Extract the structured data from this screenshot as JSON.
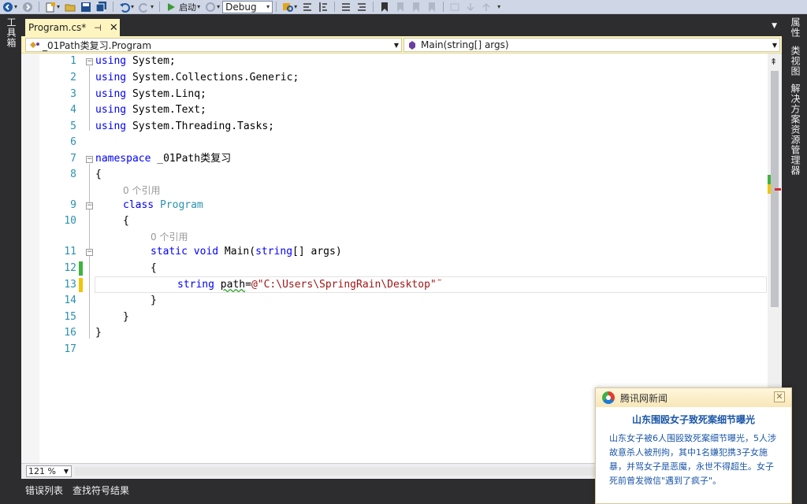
{
  "toolbar": {
    "start_label": "启动",
    "config_value": "Debug"
  },
  "left_strip": {
    "toolbox_label": "工具箱"
  },
  "right_strip": {
    "properties_label": "属性",
    "class_view_label": "类视图",
    "solution_explorer_label": "解决方案资源管理器"
  },
  "tab": {
    "title": "Program.cs*",
    "pin": "⊣",
    "close": "✕"
  },
  "nav": {
    "type_combo": "_01Path类复习.Program",
    "member_combo": "Main(string[] args)"
  },
  "editor": {
    "line_numbers": [
      "1",
      "2",
      "3",
      "4",
      "5",
      "6",
      "7",
      "8",
      "9",
      "10",
      "11",
      "12",
      "13",
      "14",
      "15",
      "16",
      "17"
    ],
    "codelens_class": "0 个引用",
    "codelens_method": "0 个引用",
    "lines": {
      "l1_kw": "using",
      "l1_rest": " System;",
      "l2_kw": "using",
      "l2_rest": " System.Collections.Generic;",
      "l3_kw": "using",
      "l3_rest": " System.Linq;",
      "l4_kw": "using",
      "l4_rest": " System.Text;",
      "l5_kw": "using",
      "l5_rest": " System.Threading.Tasks;",
      "l7_kw": "namespace",
      "l7_rest": " _01Path类复习",
      "l8": "{",
      "l9_kw": "class",
      "l9_type": "Program",
      "l10": "{",
      "l11_kw1": "static",
      "l11_kw2": "void",
      "l11_mid": " Main(",
      "l11_kw3": "string",
      "l11_end": "[] args)",
      "l12": "{",
      "l13_kw": "string",
      "l13_var": "path",
      "l13_eq": "=",
      "l13_str": "@\"C:\\Users\\SpringRain\\Desktop\"",
      "l14": "}",
      "l15": "}",
      "l16": "}"
    }
  },
  "zoom": {
    "value": "121 %"
  },
  "bottom_tabs": {
    "error_list": "错误列表",
    "find_symbol": "查找符号结果"
  },
  "news": {
    "source": "腾讯网新闻",
    "headline": "山东围殴女子致死案细节曝光",
    "body": "山东女子被6人围殴致死案细节曝光，5人涉故意杀人被刑拘，其中1名嫌犯携3子女施暴，并骂女子是恶魔，永世不得超生。女子死前曾发微信\"遇到了疯子\"。",
    "close": "✕"
  },
  "colors": {
    "keyword": "#0000ff",
    "type": "#2b91af",
    "string": "#a31515",
    "saved_change": "#3fb43f",
    "unsaved_change": "#f2c500"
  }
}
